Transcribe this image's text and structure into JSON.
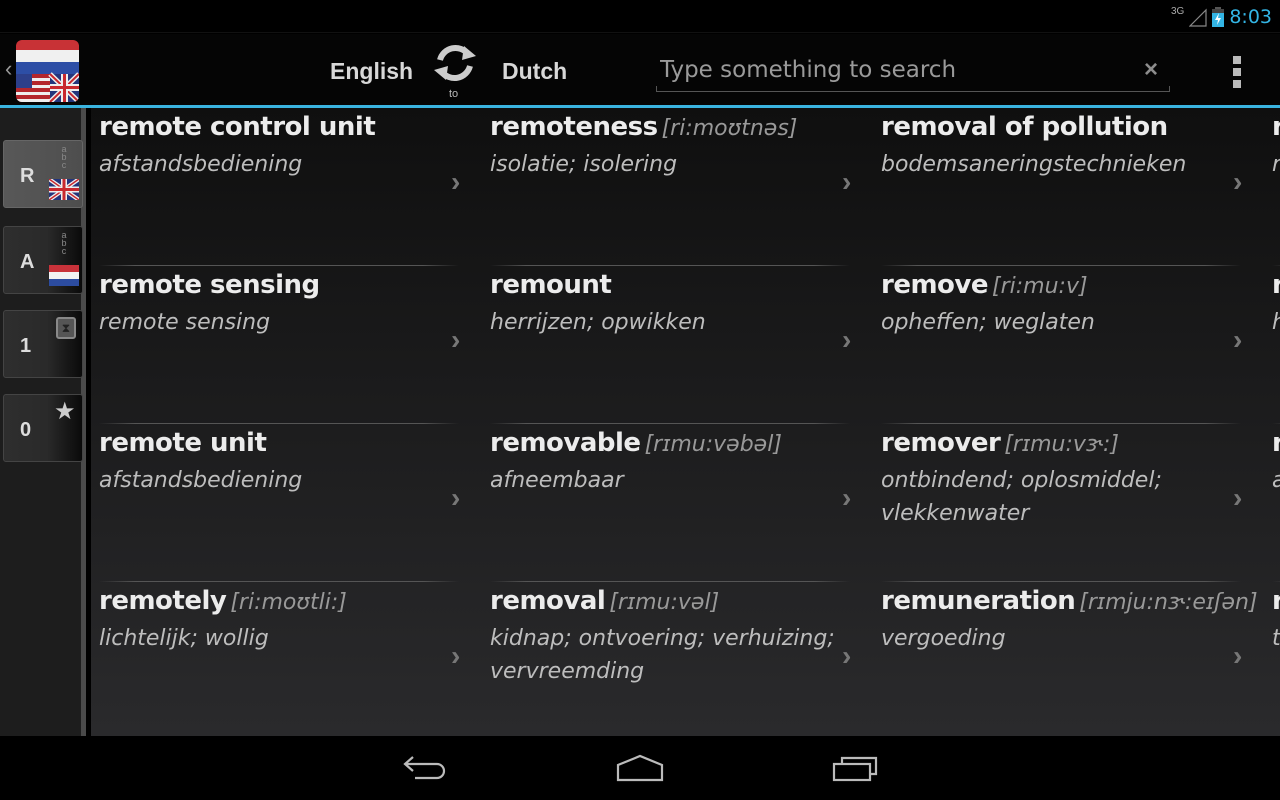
{
  "status_bar": {
    "network": "3G",
    "time": "8:03",
    "accent_color": "#33b5e5"
  },
  "action_bar": {
    "source_language": "English",
    "swap_caption": "to",
    "target_language": "Dutch",
    "search": {
      "value": "",
      "placeholder": "Type something to search"
    },
    "clear_icon": "×",
    "icons": [
      "back-chevron-icon",
      "app-logo-flags",
      "swap-languages-icon",
      "clear-icon",
      "overflow-menu-icon"
    ]
  },
  "sidebar": {
    "buttons": [
      {
        "label": "R",
        "icon": "english-alphabet-icon",
        "flag": "uk",
        "active": true
      },
      {
        "label": "A",
        "icon": "dutch-alphabet-icon",
        "flag": "nl",
        "active": false
      },
      {
        "label": "1",
        "icon": "history-hourglass-icon",
        "active": false
      },
      {
        "label": "0",
        "icon": "favorites-star-icon",
        "active": false
      }
    ]
  },
  "entries": [
    {
      "word": "remote control unit",
      "pron": "",
      "trans": "afstandsbediening"
    },
    {
      "word": "remoteness",
      "pron": "[ri:moʊtnəs]",
      "trans": "isolatie; isolering"
    },
    {
      "word": "removal of pollution",
      "pron": "",
      "trans": "bodemsaneringstechnieken"
    },
    {
      "word": "r",
      "pron": "",
      "trans": "r"
    },
    {
      "word": "remote sensing",
      "pron": "",
      "trans": "remote sensing"
    },
    {
      "word": "remount",
      "pron": "",
      "trans": "herrijzen; opwikken"
    },
    {
      "word": "remove",
      "pron": "[ri:mu:v]",
      "trans": "opheffen; weglaten"
    },
    {
      "word": "r",
      "pron": "",
      "trans": "h"
    },
    {
      "word": "remote unit",
      "pron": "",
      "trans": "afstandsbediening"
    },
    {
      "word": "removable",
      "pron": "[rɪmu:vəbəl]",
      "trans": "afneembaar"
    },
    {
      "word": "remover",
      "pron": "[rɪmu:vɝ:]",
      "trans": "ontbindend; oplosmiddel; vlekkenwater"
    },
    {
      "word": "r",
      "pron": "",
      "trans": "a a"
    },
    {
      "word": "remotely",
      "pron": "[ri:moʊtli:]",
      "trans": "lichtelijk; wollig"
    },
    {
      "word": "removal",
      "pron": "[rɪmu:vəl]",
      "trans": "kidnap; ontvoering; verhuizing; vervreemding"
    },
    {
      "word": "remuneration",
      "pron": "[rɪmju:nɝ:eɪʃən]",
      "trans": "vergoeding"
    },
    {
      "word": "r",
      "pron": "",
      "trans": "t"
    }
  ],
  "nav_bar": {
    "buttons": [
      "back-icon",
      "home-icon",
      "recent-apps-icon"
    ]
  }
}
